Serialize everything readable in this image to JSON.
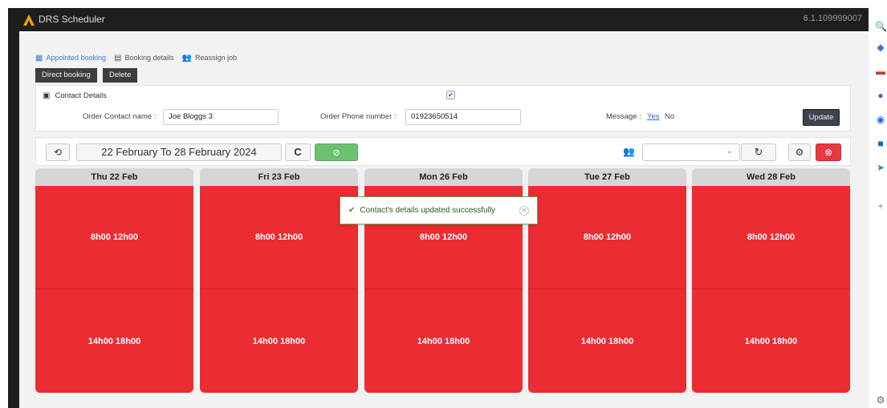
{
  "app": {
    "title": "DRS Scheduler",
    "version": "6.1.109999007"
  },
  "nav_tabs": [
    {
      "label": "Appointed booking",
      "icon": "calendar-icon"
    },
    {
      "label": "Booking details",
      "icon": "document-icon"
    },
    {
      "label": "Reassign job",
      "icon": "users-icon"
    }
  ],
  "actions": {
    "direct_booking": "Direct booking",
    "delete": "Delete"
  },
  "contact": {
    "heading": "Contact Details",
    "checkbox_checked": true,
    "name_label": "Order Contact name :",
    "name_value": "Joe Bloggs 3",
    "phone_label": "Order Phone number :",
    "phone_value": "01923650514",
    "message_label": "Message :",
    "message_yes": "Yes",
    "message_no": "No",
    "update": "Update"
  },
  "toolbar": {
    "date_range": "22 February To 28 February 2024",
    "history_icon": "history-icon",
    "refresh_icon": "refresh-c-icon",
    "confirm_icon": "check-circle-icon",
    "people_icon": "people-icon",
    "reload_icon": "reload-icon",
    "settings_icon": "gear-icon",
    "cancel_icon": "close-circle-icon"
  },
  "days": [
    {
      "header": "Thu 22 Feb",
      "slots": [
        "8h00 12h00",
        "14h00 18h00"
      ]
    },
    {
      "header": "Fri 23 Feb",
      "slots": [
        "8h00 12h00",
        "14h00 18h00"
      ]
    },
    {
      "header": "Mon 26 Feb",
      "slots": [
        "8h00 12h00",
        "14h00 18h00"
      ]
    },
    {
      "header": "Tue 27 Feb",
      "slots": [
        "8h00 12h00",
        "14h00 18h00"
      ]
    },
    {
      "header": "Wed 28 Feb",
      "slots": [
        "8h00 12h00",
        "14h00 18h00"
      ]
    }
  ],
  "toast": {
    "message": "Contact's details updated successfully"
  },
  "colors": {
    "slot_red": "#eb2c33",
    "accent_blue": "#3a7bd5",
    "success_green": "#68a94a"
  }
}
